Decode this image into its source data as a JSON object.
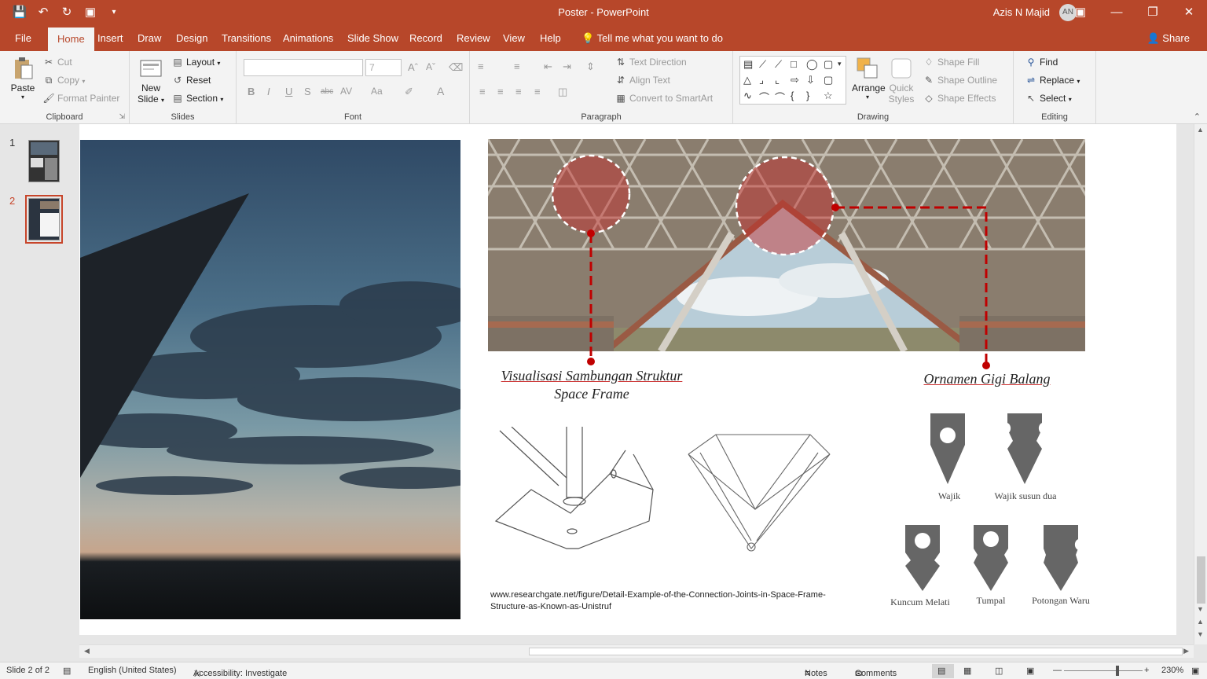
{
  "window": {
    "doc_title": "Poster  -  PowerPoint",
    "user": "Azis N Majid",
    "avatar_initials": "AN"
  },
  "menu": {
    "tabs": [
      "File",
      "Home",
      "Insert",
      "Draw",
      "Design",
      "Transitions",
      "Animations",
      "Slide Show",
      "Record",
      "Review",
      "View",
      "Help"
    ],
    "active_tab": "Home",
    "tell_me": "Tell me what you want to do",
    "share": "Share"
  },
  "ribbon": {
    "clipboard": {
      "paste": "Paste",
      "cut": "Cut",
      "copy": "Copy",
      "format_painter": "Format Painter",
      "label": "Clipboard"
    },
    "slides": {
      "new_slide": "New",
      "new_slide2": "Slide",
      "layout": "Layout",
      "reset": "Reset",
      "section": "Section",
      "label": "Slides"
    },
    "font": {
      "label": "Font",
      "font_size": "7"
    },
    "paragraph": {
      "text_direction": "Text Direction",
      "align_text": "Align Text",
      "convert_smartart": "Convert to SmartArt",
      "label": "Paragraph"
    },
    "drawing": {
      "arrange": "Arrange",
      "quick_styles": "Quick",
      "quick_styles2": "Styles",
      "shape_fill": "Shape Fill",
      "shape_outline": "Shape Outline",
      "shape_effects": "Shape Effects",
      "label": "Drawing"
    },
    "editing": {
      "find": "Find",
      "replace": "Replace",
      "select": "Select",
      "label": "Editing"
    }
  },
  "thumbnails": [
    {
      "number": "1",
      "selected": false
    },
    {
      "number": "2",
      "selected": true
    }
  ],
  "slide": {
    "caption_struktur_line1": "Visualisasi Sambungan Struktur",
    "caption_struktur_line2": "Space Frame",
    "caption_ornamen": "Ornamen Gigi Balang",
    "ornaments": [
      "Wajik",
      "Wajik susun dua",
      "Kuncum Melati",
      "Tumpal",
      "Potongan Waru"
    ],
    "source_url": "www.researchgate.net/figure/Detail-Example-of-the-Connection-Joints-in-Space-Frame-Structure-as-Known-as-Unistruf",
    "accent_color": "#c00000"
  },
  "status": {
    "slide_of": "Slide 2 of 2",
    "language": "English (United States)",
    "accessibility": "Accessibility: Investigate",
    "notes": "Notes",
    "comments": "Comments",
    "zoom": "230%"
  }
}
